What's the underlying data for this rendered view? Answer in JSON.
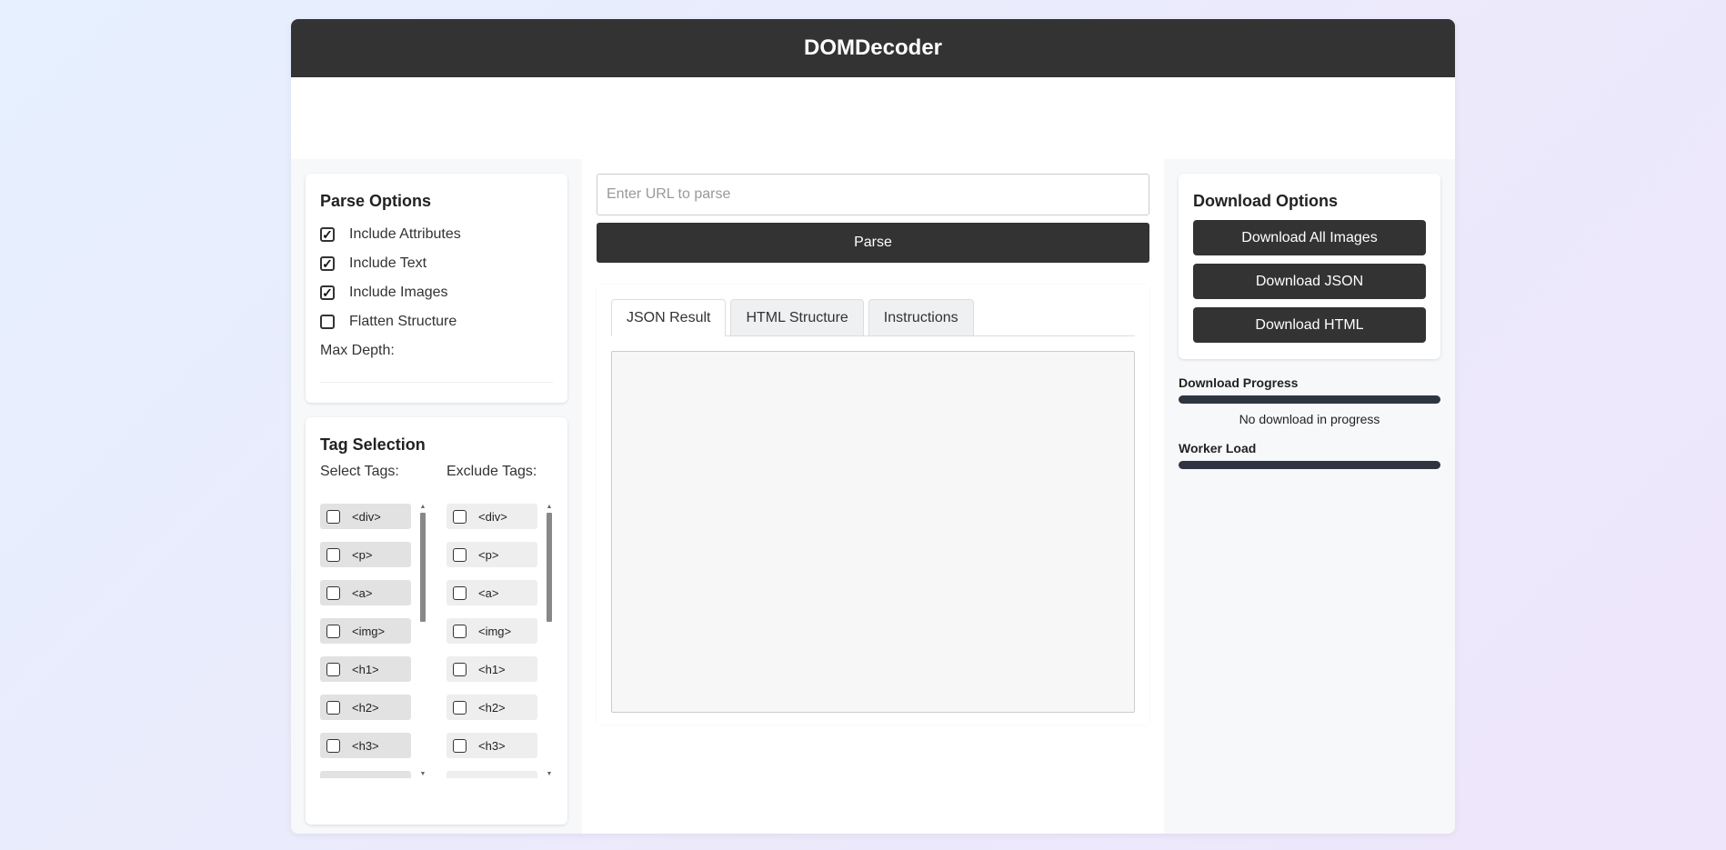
{
  "app": {
    "title": "DOMDecoder"
  },
  "parse_options": {
    "title": "Parse Options",
    "options": [
      {
        "label": "Include Attributes",
        "checked": true
      },
      {
        "label": "Include Text",
        "checked": true
      },
      {
        "label": "Include Images",
        "checked": true
      },
      {
        "label": "Flatten Structure",
        "checked": false
      }
    ],
    "max_depth_label": "Max Depth:"
  },
  "tag_selection": {
    "title": "Tag Selection",
    "select_label": "Select Tags:",
    "exclude_label": "Exclude Tags:",
    "tags": [
      "<div>",
      "<p>",
      "<a>",
      "<img>",
      "<h1>",
      "<h2>",
      "<h3>"
    ]
  },
  "main": {
    "url_placeholder": "Enter URL to parse",
    "parse_label": "Parse",
    "tabs": [
      {
        "label": "JSON Result",
        "active": true
      },
      {
        "label": "HTML Structure",
        "active": false
      },
      {
        "label": "Instructions",
        "active": false
      }
    ]
  },
  "download": {
    "title": "Download Options",
    "buttons": [
      "Download All Images",
      "Download JSON",
      "Download HTML"
    ],
    "progress_label": "Download Progress",
    "progress_status": "No download in progress",
    "worker_label": "Worker Load"
  }
}
